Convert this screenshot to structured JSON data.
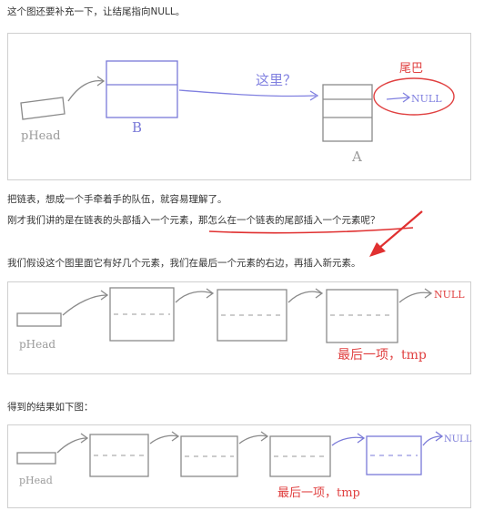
{
  "paragraphs": {
    "p1": "这个图还要补充一下，让结尾指向NULL。",
    "p2": "把链表，想成一个手牵着手的队伍，就容易理解了。",
    "p3": "刚才我们讲的是在链表的头部插入一个元素，那怎么在一个链表的尾部插入一个元素呢？",
    "p4": "我们假设这个图里面它有好几个元素，我们在最后一个元素的右边，再插入新元素。",
    "p5": "得到的结果如下图："
  },
  "diagram1": {
    "phead_label": "pHead",
    "node_b_label": "B",
    "node_a_label": "A",
    "here_label": "这里？",
    "tail_label": "尾巴",
    "null_label": "NULL"
  },
  "diagram2": {
    "phead_label": "pHead",
    "null_label": "NULL",
    "last_label": "最后一项，tmp"
  },
  "diagram3": {
    "phead_label": "pHead",
    "null_label": "NULL",
    "last_label": "最后一项，tmp"
  },
  "colors": {
    "ink": "#8a8a8a",
    "blue": "#7a7ad8",
    "red": "#e04040",
    "annot_red": "#e03030"
  }
}
